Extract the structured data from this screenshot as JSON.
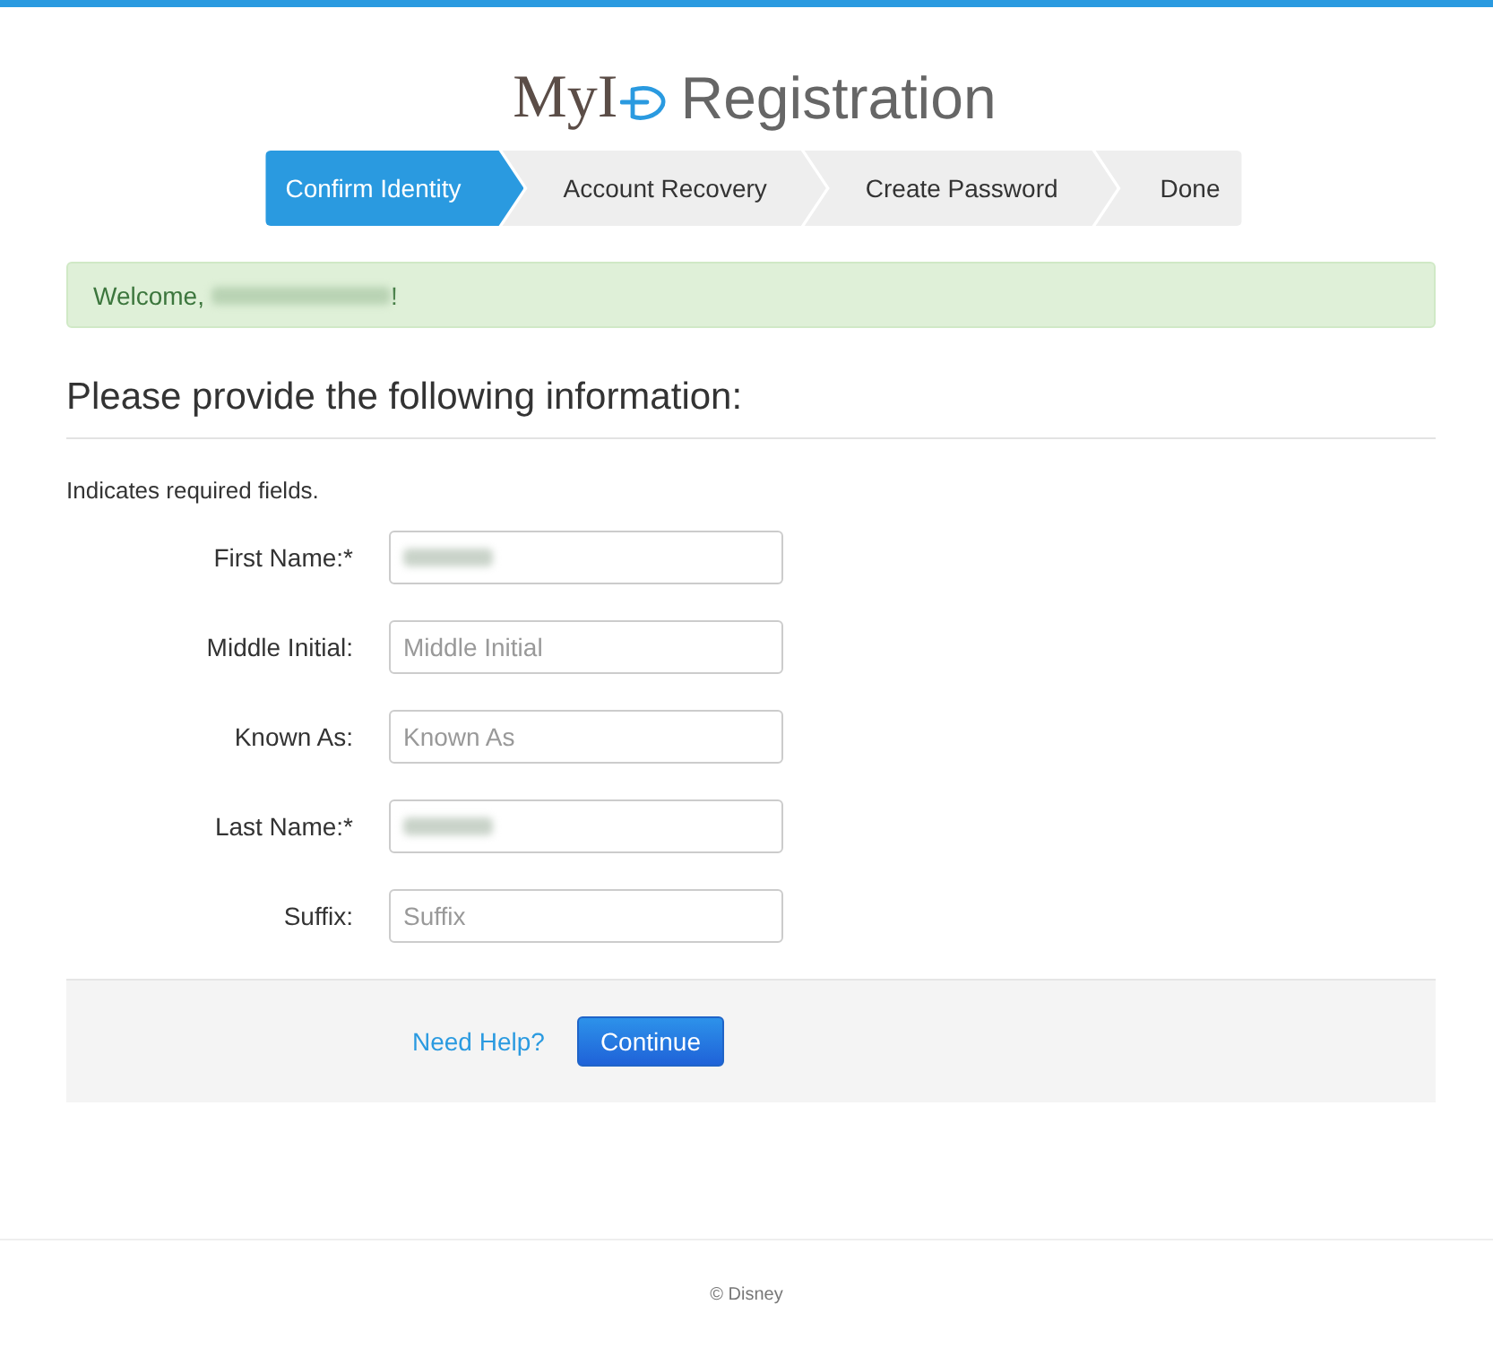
{
  "header": {
    "logo_text": "MyI",
    "title": "Registration"
  },
  "steps": [
    {
      "label": "Confirm Identity",
      "selected": true
    },
    {
      "label": "Account Recovery",
      "selected": false
    },
    {
      "label": "Create Password",
      "selected": false
    },
    {
      "label": "Done",
      "selected": false
    }
  ],
  "alert": {
    "greeting": "Welcome,",
    "name_redacted": true,
    "ending": "!"
  },
  "form": {
    "heading": "Please provide the following information:",
    "required_note": "Indicates required fields.",
    "fields": [
      {
        "label": "First Name:*",
        "redacted": true
      },
      {
        "label": "Middle Initial:",
        "placeholder": "Middle Initial",
        "redacted": false
      },
      {
        "label": "Known As:",
        "placeholder": "Known As",
        "redacted": false
      },
      {
        "label": "Last Name:*",
        "redacted": true
      },
      {
        "label": "Suffix:",
        "placeholder": "Suffix",
        "redacted": false
      }
    ]
  },
  "actions": {
    "help_link": "Need Help?",
    "continue_button": "Continue"
  },
  "footer": {
    "copyright": "© Disney"
  }
}
